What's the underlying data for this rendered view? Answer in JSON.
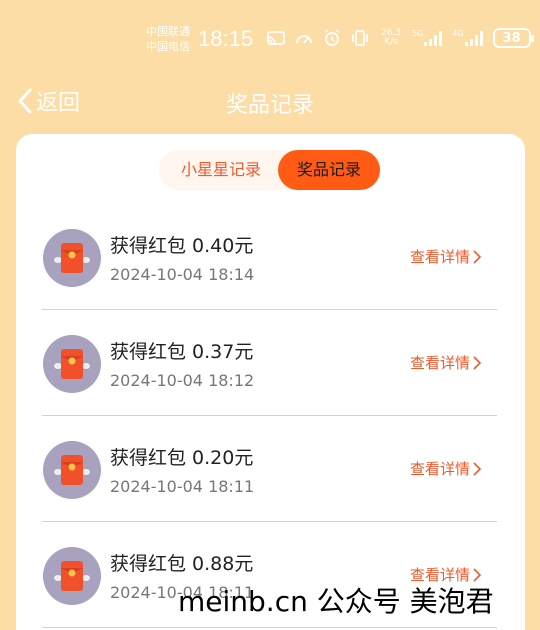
{
  "status_bar": {
    "carrier_1": "中国联通",
    "carrier_2": "中国电信",
    "time": "18:15",
    "net_speed_value": "26.3",
    "net_speed_unit": "K/s",
    "signal_1_label": "5G",
    "signal_2_label": "4G",
    "battery": "38"
  },
  "nav": {
    "back_label": "返回",
    "title": "奖品记录"
  },
  "tabs": {
    "inactive": "小星星记录",
    "active": "奖品记录"
  },
  "records": [
    {
      "title": "获得红包 0.40元",
      "time": "2024-10-04 18:14",
      "detail": "查看详情"
    },
    {
      "title": "获得红包 0.37元",
      "time": "2024-10-04 18:12",
      "detail": "查看详情"
    },
    {
      "title": "获得红包 0.20元",
      "time": "2024-10-04 18:11",
      "detail": "查看详情"
    },
    {
      "title": "获得红包 0.88元",
      "time": "2024-10-04 18:11",
      "detail": "查看详情"
    }
  ],
  "watermark": "meinb.cn  公众号 美泡君",
  "colors": {
    "background": "#FDDDA6",
    "accent": "#FF5B14",
    "link": "#F25A2E"
  }
}
